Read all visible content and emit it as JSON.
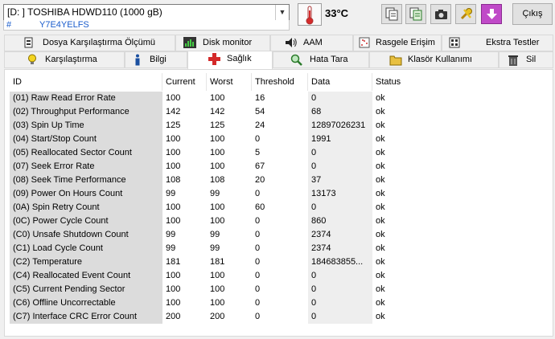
{
  "drive": {
    "selected": "[D: ] TOSHIBA HDWD110 (1000 gB)",
    "hash": "#",
    "serial": "Y7E4YELFS"
  },
  "temperature": "33°C",
  "exit_label": "Çıkış",
  "colors": {
    "serial_text": "#1a5ccc",
    "red_icon": "#d42a2a",
    "purple_button": "#c04ac8"
  },
  "tabs_row1": [
    {
      "label": "Dosya Karşılaştırma Ölçümü",
      "icon": "file-compare-icon"
    },
    {
      "label": "Disk monitor",
      "icon": "disk-monitor-icon"
    },
    {
      "label": "AAM",
      "icon": "speaker-icon"
    },
    {
      "label": "Rasgele Erişim",
      "icon": "random-access-icon"
    },
    {
      "label": "Ekstra Testler",
      "icon": "extra-tests-icon"
    }
  ],
  "tabs_row2": [
    {
      "label": "Karşılaştırma",
      "icon": "lightbulb-icon"
    },
    {
      "label": "Bilgi",
      "icon": "info-icon"
    },
    {
      "label": "Sağlık",
      "icon": "red-cross-icon"
    },
    {
      "label": "Hata Tara",
      "icon": "magnifier-icon"
    },
    {
      "label": "Klasör Kullanımı",
      "icon": "folder-icon"
    },
    {
      "label": "Sil",
      "icon": "trash-icon"
    }
  ],
  "active_tab": "Sağlık",
  "table": {
    "headers": [
      "ID",
      "Current",
      "Worst",
      "Threshold",
      "Data",
      "Status"
    ],
    "rows": [
      [
        "(01) Raw Read Error Rate",
        "100",
        "100",
        "16",
        "0",
        "ok"
      ],
      [
        "(02) Throughput Performance",
        "142",
        "142",
        "54",
        "68",
        "ok"
      ],
      [
        "(03) Spin Up Time",
        "125",
        "125",
        "24",
        "12897026231",
        "ok"
      ],
      [
        "(04) Start/Stop Count",
        "100",
        "100",
        "0",
        "1991",
        "ok"
      ],
      [
        "(05) Reallocated Sector Count",
        "100",
        "100",
        "5",
        "0",
        "ok"
      ],
      [
        "(07) Seek Error Rate",
        "100",
        "100",
        "67",
        "0",
        "ok"
      ],
      [
        "(08) Seek Time Performance",
        "108",
        "108",
        "20",
        "37",
        "ok"
      ],
      [
        "(09) Power On Hours Count",
        "99",
        "99",
        "0",
        "13173",
        "ok"
      ],
      [
        "(0A) Spin Retry Count",
        "100",
        "100",
        "60",
        "0",
        "ok"
      ],
      [
        "(0C) Power Cycle Count",
        "100",
        "100",
        "0",
        "860",
        "ok"
      ],
      [
        "(C0) Unsafe Shutdown Count",
        "99",
        "99",
        "0",
        "2374",
        "ok"
      ],
      [
        "(C1) Load Cycle Count",
        "99",
        "99",
        "0",
        "2374",
        "ok"
      ],
      [
        "(C2) Temperature",
        "181",
        "181",
        "0",
        "184683855...",
        "ok"
      ],
      [
        "(C4) Reallocated Event Count",
        "100",
        "100",
        "0",
        "0",
        "ok"
      ],
      [
        "(C5) Current Pending Sector",
        "100",
        "100",
        "0",
        "0",
        "ok"
      ],
      [
        "(C6) Offline Uncorrectable",
        "100",
        "100",
        "0",
        "0",
        "ok"
      ],
      [
        "(C7) Interface CRC Error Count",
        "200",
        "200",
        "0",
        "0",
        "ok"
      ]
    ]
  }
}
